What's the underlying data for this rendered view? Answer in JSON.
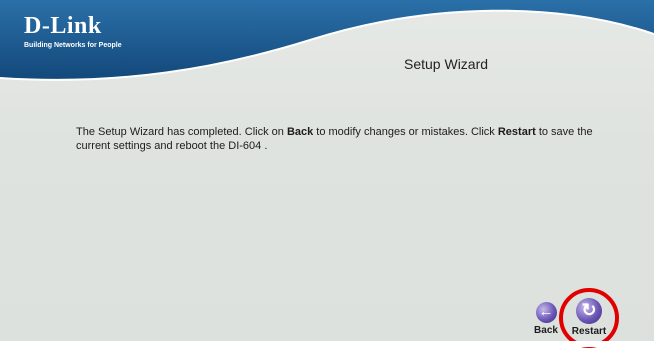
{
  "header": {
    "brand": "D-Link",
    "tagline": "Building Networks for People"
  },
  "page": {
    "title": "Setup Wizard"
  },
  "message": {
    "part1": "The Setup Wizard has completed. Click on ",
    "back_word": "Back",
    "part2": " to modify changes or mistakes. Click ",
    "restart_word": "Restart",
    "part3": " to save the current settings and reboot the DI-604 ."
  },
  "buttons": {
    "back": {
      "label": "Back",
      "icon": "back-arrow-icon",
      "glyph": "←"
    },
    "restart": {
      "label": "Restart",
      "icon": "restart-icon",
      "glyph": "↻"
    }
  },
  "colors": {
    "header_blue": "#1f5e92",
    "button_purple": "#6b56b6",
    "highlight_red": "#e00000"
  }
}
